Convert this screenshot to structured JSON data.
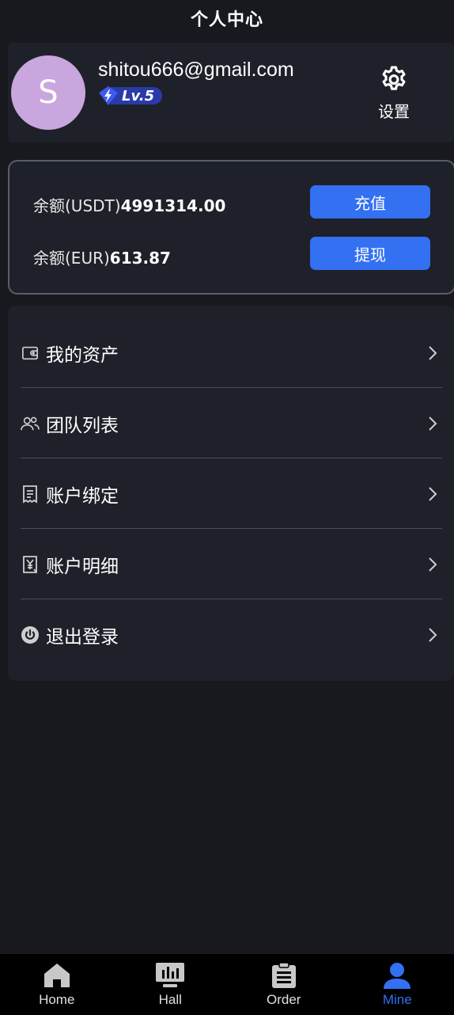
{
  "header": {
    "title": "个人中心"
  },
  "profile": {
    "avatar_letter": "S",
    "email": "shitou666@gmail.com",
    "level": "Lv.5",
    "settings_label": "设置"
  },
  "balance": {
    "usdt_label": "余额(USDT)",
    "usdt_value": "4991314.00",
    "eur_label": "余额(EUR)",
    "eur_value": "613.87",
    "recharge_label": "充值",
    "withdraw_label": "提现"
  },
  "menu": {
    "items": [
      {
        "label": "我的资产",
        "icon": "wallet-icon"
      },
      {
        "label": "团队列表",
        "icon": "team-icon"
      },
      {
        "label": "账户绑定",
        "icon": "receipt-icon"
      },
      {
        "label": "账户明细",
        "icon": "yen-document-icon"
      },
      {
        "label": "退出登录",
        "icon": "power-icon"
      }
    ]
  },
  "bottom_nav": {
    "items": [
      {
        "label": "Home",
        "icon": "home-icon",
        "active": false
      },
      {
        "label": "Hall",
        "icon": "chart-monitor-icon",
        "active": false
      },
      {
        "label": "Order",
        "icon": "clipboard-icon",
        "active": false
      },
      {
        "label": "Mine",
        "icon": "user-icon",
        "active": true
      }
    ]
  },
  "colors": {
    "background": "#17191e",
    "card": "#1e2129",
    "accent": "#3370f2",
    "avatar": "#c9a6dd",
    "level_badge": "#2a3aa8"
  }
}
